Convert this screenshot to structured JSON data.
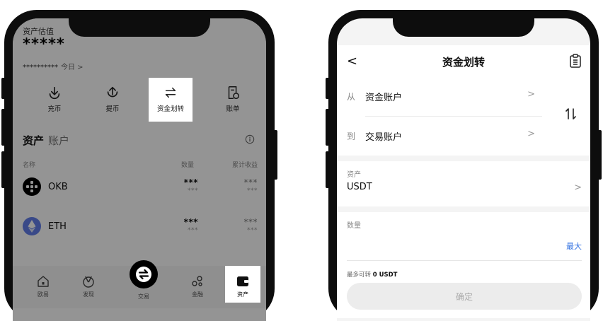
{
  "left": {
    "top_label": "资产估值",
    "masked_total": "*****",
    "masked_sub": "**********",
    "today_label": "今日 >",
    "actions": [
      {
        "label": "充币",
        "icon": "deposit-icon"
      },
      {
        "label": "提币",
        "icon": "withdraw-icon"
      },
      {
        "label": "资金划转",
        "icon": "transfer-icon"
      },
      {
        "label": "账单",
        "icon": "bill-icon"
      }
    ],
    "assets_title": "资产",
    "account_title": "账户",
    "columns": {
      "name": "名称",
      "quantity": "数量",
      "earnings": "累计收益"
    },
    "coins": [
      {
        "name": "OKB",
        "qty_main": "***",
        "qty_sub": "***",
        "earn_main": "***",
        "earn_sub": "***",
        "icon": "okb-icon"
      },
      {
        "name": "ETH",
        "qty_main": "***",
        "qty_sub": "***",
        "earn_main": "***",
        "earn_sub": "***",
        "icon": "eth-icon"
      }
    ],
    "tabs": [
      {
        "label": "欧易",
        "icon": "home-icon"
      },
      {
        "label": "发现",
        "icon": "discover-icon"
      },
      {
        "label": "交易",
        "icon": "trade-icon"
      },
      {
        "label": "金融",
        "icon": "finance-icon"
      },
      {
        "label": "资产",
        "icon": "wallet-icon"
      }
    ]
  },
  "right": {
    "back_label": "<",
    "title": "资金划转",
    "from_label": "从",
    "from_value": "资金账户",
    "to_label": "到",
    "to_value": "交易账户",
    "chevron": ">",
    "asset_label": "资产",
    "asset_value": "USDT",
    "amount_label": "数量",
    "amount_value": "",
    "max_label": "最大",
    "available_label": "最多可转",
    "available_value": "0 USDT",
    "confirm_label": "确定"
  },
  "colors": {
    "accent": "#2f6fe0",
    "overlay": "#000000",
    "phone": "#0d0d0d"
  }
}
